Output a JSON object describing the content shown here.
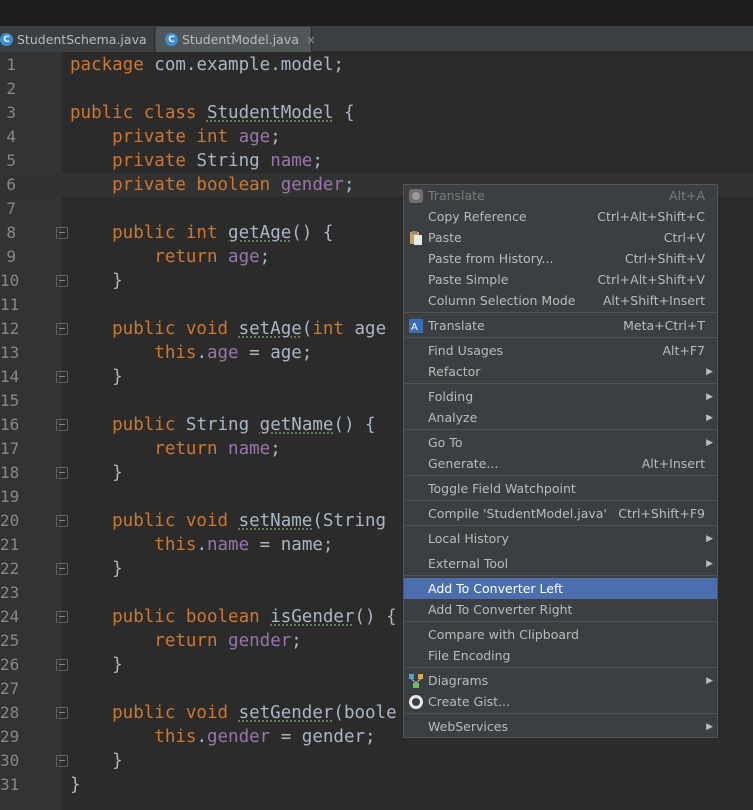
{
  "tabs": [
    {
      "label": "StudentSchema.java",
      "icon": "java-class-icon"
    },
    {
      "label": "StudentModel.java",
      "icon": "java-class-icon"
    }
  ],
  "editor": {
    "lines": [
      {
        "n": "1"
      },
      {
        "n": "2"
      },
      {
        "n": "3"
      },
      {
        "n": "4"
      },
      {
        "n": "5"
      },
      {
        "n": "6"
      },
      {
        "n": "7"
      },
      {
        "n": "8"
      },
      {
        "n": "9"
      },
      {
        "n": "10"
      },
      {
        "n": "11"
      },
      {
        "n": "12"
      },
      {
        "n": "13"
      },
      {
        "n": "14"
      },
      {
        "n": "15"
      },
      {
        "n": "16"
      },
      {
        "n": "17"
      },
      {
        "n": "18"
      },
      {
        "n": "19"
      },
      {
        "n": "20"
      },
      {
        "n": "21"
      },
      {
        "n": "22"
      },
      {
        "n": "23"
      },
      {
        "n": "24"
      },
      {
        "n": "25"
      },
      {
        "n": "26"
      },
      {
        "n": "27"
      },
      {
        "n": "28"
      },
      {
        "n": "29"
      },
      {
        "n": "30"
      },
      {
        "n": "31"
      }
    ],
    "code": {
      "l1": [
        "package",
        " com.example.model;"
      ],
      "l3": [
        "public class ",
        "StudentModel",
        " {"
      ],
      "l4": [
        "    private int ",
        "age",
        ";"
      ],
      "l5": [
        "    private ",
        "String ",
        "name",
        ";"
      ],
      "l6": [
        "    private boolean ",
        "gender",
        ";"
      ],
      "l8": [
        "    public int ",
        "getAge",
        "() {"
      ],
      "l9": [
        "        return ",
        "age",
        ";"
      ],
      "l10": [
        "    }"
      ],
      "l12": [
        "    public void ",
        "setAge",
        "(",
        "int ",
        "age"
      ],
      "l13": [
        "        this",
        ".",
        "age",
        " = age;"
      ],
      "l14": [
        "    }"
      ],
      "l16": [
        "    public ",
        "String ",
        "getName",
        "() {"
      ],
      "l17": [
        "        return ",
        "name",
        ";"
      ],
      "l18": [
        "    }"
      ],
      "l20": [
        "    public void ",
        "setName",
        "(String"
      ],
      "l21": [
        "        this",
        ".",
        "name",
        " = name;"
      ],
      "l22": [
        "    }"
      ],
      "l24": [
        "    public boolean ",
        "isGender",
        "() {"
      ],
      "l25": [
        "        return ",
        "gender",
        ";"
      ],
      "l26": [
        "    }"
      ],
      "l28": [
        "    public void ",
        "setGender",
        "(boole"
      ],
      "l29": [
        "        this",
        ".",
        "gender",
        " = gender;"
      ],
      "l30": [
        "    }"
      ],
      "l31": [
        "}"
      ]
    }
  },
  "context_menu": {
    "items": [
      {
        "label": "Translate",
        "shortcut": "Alt+A",
        "disabled": true,
        "icon": "translate-gray-icon"
      },
      {
        "label": "Copy Reference",
        "shortcut": "Ctrl+Alt+Shift+C"
      },
      {
        "label": "Paste",
        "shortcut": "Ctrl+V",
        "icon": "paste-icon"
      },
      {
        "label": "Paste from History...",
        "shortcut": "Ctrl+Shift+V"
      },
      {
        "label": "Paste Simple",
        "shortcut": "Ctrl+Alt+Shift+V"
      },
      {
        "label": "Column Selection Mode",
        "shortcut": "Alt+Shift+Insert"
      },
      {
        "label": "Translate",
        "shortcut": "Meta+Ctrl+T",
        "icon": "translate-icon"
      },
      {
        "label": "Find Usages",
        "shortcut": "Alt+F7"
      },
      {
        "label": "Refactor",
        "submenu": true
      },
      {
        "label": "Folding",
        "submenu": true
      },
      {
        "label": "Analyze",
        "submenu": true
      },
      {
        "label": "Go To",
        "submenu": true
      },
      {
        "label": "Generate...",
        "shortcut": "Alt+Insert"
      },
      {
        "label": "Toggle Field Watchpoint"
      },
      {
        "label": "Compile 'StudentModel.java'",
        "shortcut": "Ctrl+Shift+F9"
      },
      {
        "label": "Local History",
        "submenu": true
      },
      {
        "label": "External Tool",
        "submenu": true
      },
      {
        "label": "Add To Converter Left",
        "highlighted": true
      },
      {
        "label": "Add To Converter Right"
      },
      {
        "label": "Compare with Clipboard"
      },
      {
        "label": "File Encoding"
      },
      {
        "label": "Diagrams",
        "submenu": true,
        "icon": "diagrams-icon"
      },
      {
        "label": "Create Gist...",
        "icon": "github-icon"
      },
      {
        "label": "WebServices",
        "submenu": true
      }
    ],
    "colors": {
      "highlight": "#4b6eaf",
      "background": "#3c3f41"
    }
  },
  "syntax_colors": {
    "keyword": "#cc7832",
    "field": "#9876aa",
    "text": "#a9b7c6",
    "line_number": "#888888"
  }
}
